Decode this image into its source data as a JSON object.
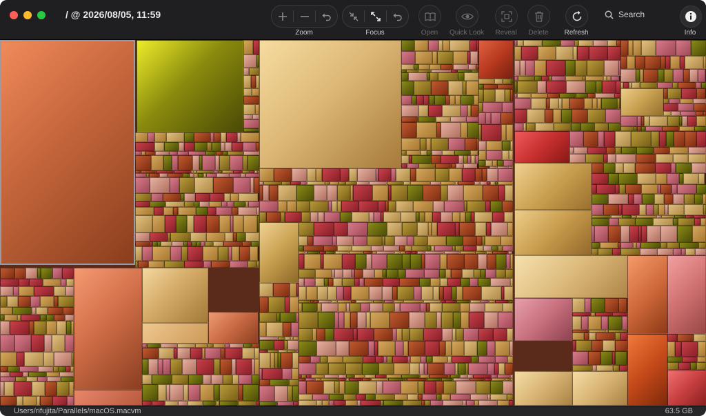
{
  "window": {
    "title": "/ @ 2026/08/05, 11:59"
  },
  "toolbar": {
    "zoom_label": "Zoom",
    "focus_label": "Focus",
    "open_label": "Open",
    "quicklook_label": "Quick Look",
    "reveal_label": "Reveal",
    "delete_label": "Delete",
    "refresh_label": "Refresh",
    "search_label": "Search",
    "info_label": "Info"
  },
  "status": {
    "path": "Users/rifujita/Parallels/macOS.macvm",
    "size": "63.5 GB"
  },
  "colors": {
    "accent_orange": "#e07a4f",
    "olive": "#7a7a10",
    "sand": "#d9b56a",
    "crimson": "#c03a3a",
    "pink": "#c96a7a"
  }
}
